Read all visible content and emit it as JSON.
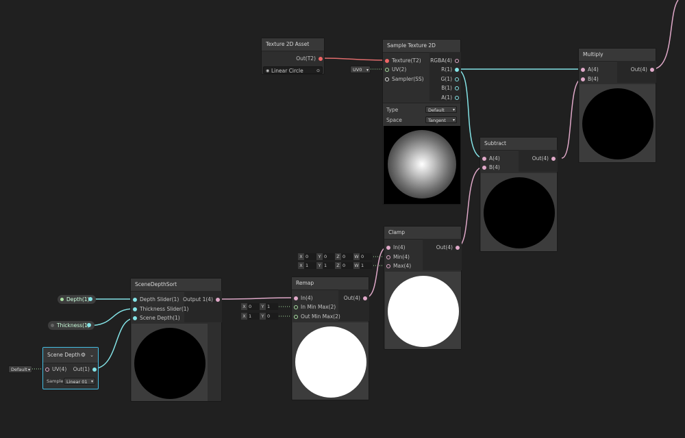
{
  "colors": {
    "background": "#202020",
    "node": "#2e2e2e",
    "header": "#383838",
    "pink_port": "#e0a9c9",
    "cyan_port": "#84e4e7",
    "red_port": "#ee6666",
    "selected_border": "#44c0e6"
  },
  "texture_asset": {
    "title": "Texture 2D Asset",
    "output": "Out(T2)",
    "value": "Linear Circle"
  },
  "sample_texture": {
    "title": "Sample Texture 2D",
    "inputs": [
      "Texture(T2)",
      "UV(2)",
      "Sampler(SS)"
    ],
    "outputs": [
      "RGBA(4)",
      "R(1)",
      "G(1)",
      "B(1)",
      "A(1)"
    ],
    "type_label": "Type",
    "type_value": "Default",
    "space_label": "Space",
    "space_value": "Tangent",
    "uv_value": "UV0"
  },
  "multiply": {
    "title": "Multiply",
    "inputs": [
      "A(4)",
      "B(4)"
    ],
    "output": "Out(4)"
  },
  "subtract": {
    "title": "Subtract",
    "inputs": [
      "A(4)",
      "B(4)"
    ],
    "output": "Out(4)"
  },
  "clamp": {
    "title": "Clamp",
    "inputs": [
      "In(4)",
      "Min(4)",
      "Max(4)"
    ],
    "output": "Out(4)",
    "min": {
      "x": "0",
      "y": "0",
      "z": "0",
      "w": "0"
    },
    "max": {
      "x": "1",
      "y": "1",
      "z": "0",
      "w": "1"
    }
  },
  "remap": {
    "title": "Remap",
    "inputs": [
      "In(4)",
      "In Min Max(2)",
      "Out Min Max(2)"
    ],
    "output": "Out(4)",
    "in_min_max": {
      "x": "0",
      "y": "1"
    },
    "out_min_max": {
      "x": "1",
      "y": "0"
    }
  },
  "scene_depth_sort": {
    "title": "SceneDepthSort",
    "inputs": [
      "Depth Slider(1)",
      "Thickness Slider(1)",
      "Scene Depth(1)"
    ],
    "output": "Output 1(4)"
  },
  "depth_prop": {
    "label": "Depth(1)"
  },
  "thickness_prop": {
    "label": "Thickness(1)"
  },
  "scene_depth": {
    "title": "Scene Depth",
    "input": "UV(4)",
    "output": "Out(1)",
    "default_value": "Default",
    "sampler_label": "Samplе",
    "sampler_value": "Linear 01"
  }
}
